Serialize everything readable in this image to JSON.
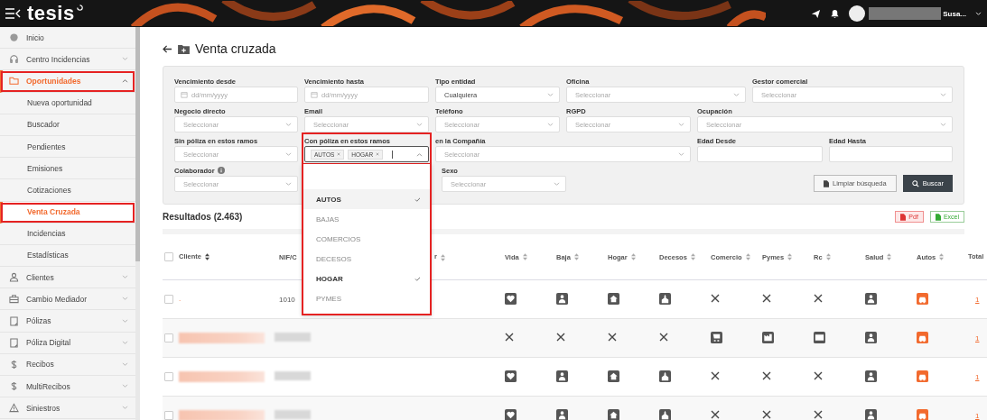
{
  "header": {
    "logo": "tesis",
    "user_name": "Susa..."
  },
  "sidebar": {
    "items": [
      {
        "label": "Inicio",
        "selected": false,
        "highlighted": false
      },
      {
        "label": "Centro Incidencias",
        "expanded": false,
        "selected": false,
        "highlighted": false
      },
      {
        "label": "Oportunidades",
        "expanded": true,
        "selected": true,
        "highlighted": true,
        "children": [
          {
            "label": "Nueva oportunidad",
            "selected": false,
            "highlighted": false
          },
          {
            "label": "Buscador",
            "selected": false,
            "highlighted": false
          },
          {
            "label": "Pendientes",
            "selected": false,
            "highlighted": false
          },
          {
            "label": "Emisiones",
            "selected": false,
            "highlighted": false
          },
          {
            "label": "Cotizaciones",
            "selected": false,
            "highlighted": false
          },
          {
            "label": "Venta Cruzada",
            "selected": true,
            "highlighted": true
          },
          {
            "label": "Incidencias",
            "selected": false,
            "highlighted": false
          },
          {
            "label": "Estadísticas",
            "selected": false,
            "highlighted": false
          }
        ]
      },
      {
        "label": "Clientes",
        "expanded": false,
        "selected": false,
        "highlighted": false
      },
      {
        "label": "Cambio Mediador",
        "expanded": false,
        "selected": false,
        "highlighted": false
      },
      {
        "label": "Pólizas",
        "expanded": false,
        "selected": false,
        "highlighted": false
      },
      {
        "label": "Póliza Digital",
        "expanded": false,
        "selected": false,
        "highlighted": false
      },
      {
        "label": "Recibos",
        "expanded": false,
        "selected": false,
        "highlighted": false
      },
      {
        "label": "MultiRecibos",
        "expanded": false,
        "selected": false,
        "highlighted": false
      },
      {
        "label": "Siniestros",
        "expanded": false,
        "selected": false,
        "highlighted": false
      }
    ]
  },
  "page": {
    "title": "Venta cruzada"
  },
  "filters": [
    [
      {
        "kind": "date",
        "label": "Vencimiento desde",
        "placeholder": "dd/mm/yyyy"
      },
      {
        "kind": "date",
        "label": "Vencimiento hasta",
        "placeholder": "dd/mm/yyyy"
      },
      {
        "kind": "select",
        "label": "Tipo entidad",
        "value": "Cualquiera"
      },
      {
        "kind": "select",
        "label": "Oficina",
        "placeholder": "Seleccionar"
      },
      {
        "kind": "select",
        "label": "Gestor comercial",
        "placeholder": "Seleccionar"
      }
    ],
    [
      {
        "kind": "select",
        "label": "Negocio directo",
        "placeholder": "Seleccionar"
      },
      {
        "kind": "select",
        "label": "Email",
        "placeholder": "Seleccionar"
      },
      {
        "kind": "select",
        "label": "Teléfono",
        "placeholder": "Seleccionar"
      },
      {
        "kind": "select",
        "label": "RGPD",
        "placeholder": "Seleccionar"
      },
      {
        "kind": "select",
        "label": "Ocupación",
        "placeholder": "Seleccionar"
      }
    ],
    [
      {
        "kind": "select",
        "label": "Sin póliza en estos ramos",
        "placeholder": "Seleccionar"
      },
      {
        "kind": "multiselect",
        "label": "Con póliza en estos ramos",
        "highlighted": true,
        "expanded": true,
        "chips": [
          "AUTOS",
          "HOGAR"
        ],
        "options": [
          {
            "label": "AUTOS",
            "selected": true
          },
          {
            "label": "BAJAS",
            "selected": false
          },
          {
            "label": "COMERCIOS",
            "selected": false
          },
          {
            "label": "DECESOS",
            "selected": false
          },
          {
            "label": "HOGAR",
            "selected": true
          },
          {
            "label": "PYMES",
            "selected": false
          }
        ]
      },
      {
        "kind": "select",
        "label": "en la Compañía",
        "placeholder": "Seleccionar"
      },
      {
        "kind": "text",
        "label": "Edad Desde"
      },
      {
        "kind": "text",
        "label": "Edad Hasta"
      }
    ],
    [
      {
        "kind": "select",
        "label": "Colaborador",
        "info": true,
        "placeholder": "Seleccionar"
      },
      {
        "kind": "select",
        "label": "Sexo",
        "placeholder": "Seleccionar"
      }
    ]
  ],
  "actions": [
    "Limpiar búsqueda",
    "Buscar"
  ],
  "results": {
    "title": "Resultados (2.463)",
    "exports": [
      "Pdf",
      "Excel"
    ]
  },
  "table": {
    "columns": [
      "Cliente",
      "NIF/C",
      "r"
    ],
    "product_columns": [
      "Vida",
      "Baja",
      "Hogar",
      "Decesos",
      "Comercio",
      "Pymes",
      "Rc",
      "Salud",
      "Autos"
    ],
    "total_column": "Total",
    "select_all": false,
    "rows": [
      {
        "client": ".",
        "nif": "1010",
        "checked": false,
        "redacted": false,
        "products": [
          true,
          true,
          true,
          true,
          false,
          false,
          false,
          true,
          true
        ],
        "total": "1"
      },
      {
        "checked": false,
        "redacted": true,
        "products": [
          false,
          false,
          false,
          false,
          true,
          true,
          true,
          true,
          true
        ],
        "total": "1"
      },
      {
        "checked": false,
        "redacted": true,
        "products": [
          true,
          true,
          true,
          true,
          false,
          false,
          false,
          true,
          true
        ],
        "total": "1"
      },
      {
        "checked": false,
        "redacted": true,
        "products": [
          true,
          true,
          true,
          true,
          false,
          false,
          false,
          true,
          true
        ],
        "total": "1"
      }
    ]
  }
}
